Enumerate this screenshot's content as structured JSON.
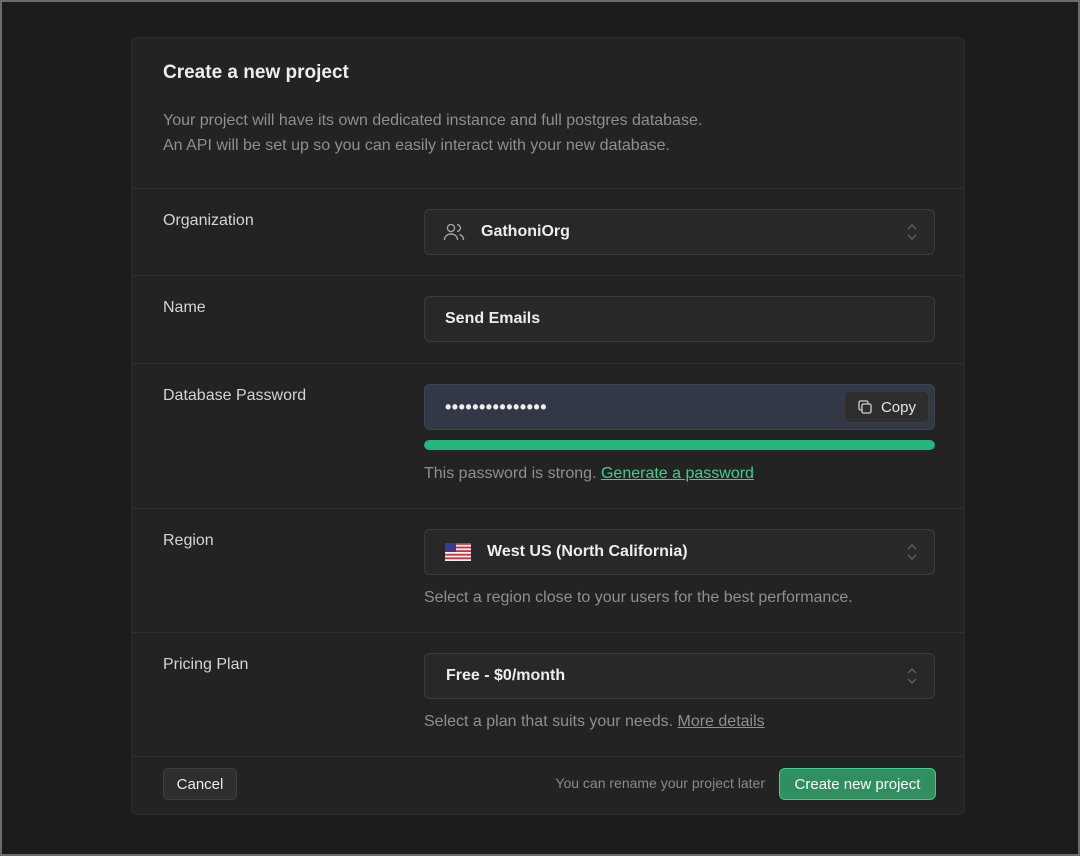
{
  "dialog": {
    "title": "Create a new project",
    "description_line1": "Your project will have its own dedicated instance and full postgres database.",
    "description_line2": "An API will be set up so you can easily interact with your new database."
  },
  "organization": {
    "label": "Organization",
    "value": "GathoniOrg",
    "icon": "users-icon"
  },
  "name": {
    "label": "Name",
    "value": "Send Emails"
  },
  "password": {
    "label": "Database Password",
    "value": "•••••••••••••••",
    "copy_label": "Copy",
    "strength": 1.0,
    "strength_color": "#24b47e",
    "helper": "This password is strong.",
    "generate_link": "Generate a password"
  },
  "region": {
    "label": "Region",
    "value": "West US (North California)",
    "icon": "us-flag-icon",
    "helper": "Select a region close to your users for the best performance."
  },
  "pricing": {
    "label": "Pricing Plan",
    "value": "Free - $0/month",
    "helper": "Select a plan that suits your needs.",
    "more_link": "More details"
  },
  "footer": {
    "cancel_label": "Cancel",
    "note": "You can rename your project later",
    "create_label": "Create new project"
  },
  "colors": {
    "background": "#1c1c1c",
    "panel": "#232323",
    "accent": "#3ecf8e"
  }
}
